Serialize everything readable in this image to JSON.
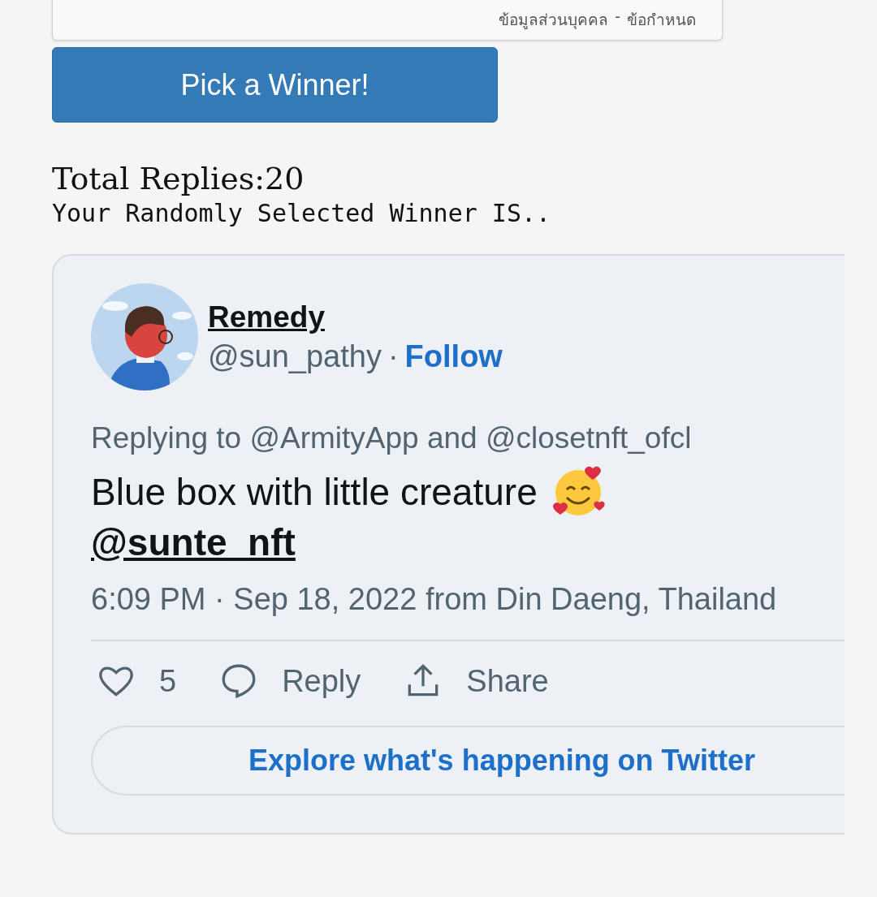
{
  "consent_card": {
    "links": [
      "ข้อมูลส่วนบุคคล",
      "ข้อกำหนด"
    ],
    "separator": "-"
  },
  "pick_button": {
    "label": "Pick a Winner!"
  },
  "total_replies": "Total Replies:20",
  "winner_heading": "Your Randomly Selected Winner IS..",
  "tweet": {
    "name": "Remedy",
    "handle": "@sun_pathy",
    "dot": "·",
    "follow": "Follow",
    "replying_to": "Replying to @ArmityApp and @closetnft_ofcl",
    "text": "Blue box with little creature",
    "mention": "@sunte_nft",
    "timestamp": "6:09 PM · Sep 18, 2022 from Din Daeng, Thailand",
    "likes": "5",
    "reply": "Reply",
    "share": "Share",
    "explore": "Explore what's happening on Twitter"
  }
}
